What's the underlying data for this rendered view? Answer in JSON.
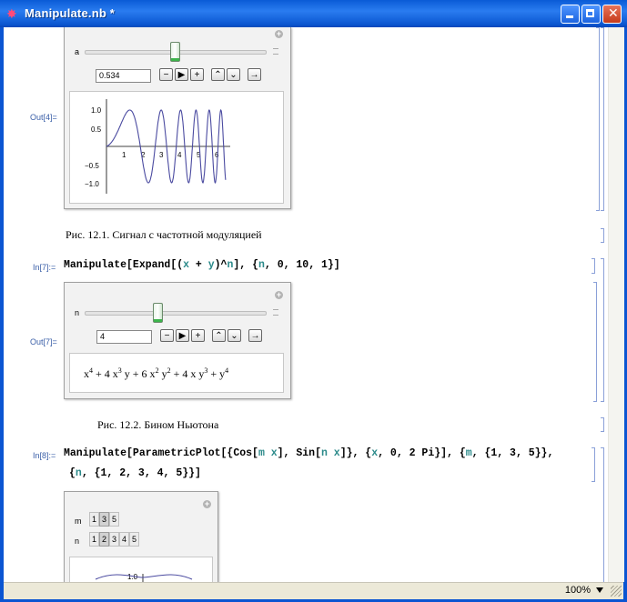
{
  "window": {
    "title": "Manipulate.nb *"
  },
  "status": {
    "zoom": "100%"
  },
  "cell1": {
    "out_label": "Out[4]=",
    "slider_label": "a",
    "slider_value_fraction": 0.5,
    "value": "0.534",
    "plot": {
      "y_ticks": [
        "1.0",
        "0.5",
        "−0.5",
        "−1.0"
      ],
      "x_ticks": [
        "1",
        "2",
        "3",
        "4",
        "5",
        "6"
      ]
    },
    "caption": "Рис. 12.1. Сигнал с частотной модуляцией"
  },
  "cell2": {
    "in_label": "In[7]:=",
    "code": {
      "p1": "Manipulate[Expand[(",
      "x": "x",
      "p2": " + ",
      "y": "y",
      "p3": ")^",
      "n": "n",
      "p4": "], {",
      "n2": "n",
      "p5": ", 0, 10, 1}]"
    },
    "out_label": "Out[7]=",
    "slider_label": "n",
    "slider_value_fraction": 0.4,
    "value": "4",
    "result": {
      "t1": "x",
      "e1": "4",
      "t2": " + 4 x",
      "e2": "3",
      "t3": " y + 6 x",
      "e3": "2",
      "t4": " y",
      "e4": "2",
      "t5": " + 4 x y",
      "e5": "3",
      "t6": " + y",
      "e6": "4"
    },
    "caption": "Рис. 12.2. Бином Ньютона"
  },
  "cell3": {
    "in_label": "In[8]:=",
    "code_line1": {
      "a": "Manipulate[ParametricPlot[{Cos[",
      "m": "m",
      "sp": " ",
      "x": "x",
      "b": "], Sin[",
      "n": "n",
      "sp2": " ",
      "x2": "x",
      "c": "]}, {",
      "x3": "x",
      "d": ", 0, 2 Pi}], {",
      "m2": "m",
      "e": ", {1, 3, 5}},"
    },
    "code_line2": {
      "a": "{",
      "n": "n",
      "b": ", {1, 2, 3, 4, 5}}]"
    },
    "m_label": "m",
    "m_options": [
      "1",
      "3",
      "5"
    ],
    "m_selected": 1,
    "n_label": "n",
    "n_options": [
      "1",
      "2",
      "3",
      "4",
      "5"
    ],
    "n_selected": 1,
    "plot_tick": "1.0"
  },
  "controls": {
    "minus": "−",
    "play": "▶",
    "plus": "+",
    "faster": "⌃",
    "slower": "⌄",
    "dir": "→"
  },
  "icons": {
    "app": "mathematica-star-icon",
    "minimize": "minimize-icon",
    "maximize": "maximize-icon",
    "close": "close-icon"
  }
}
